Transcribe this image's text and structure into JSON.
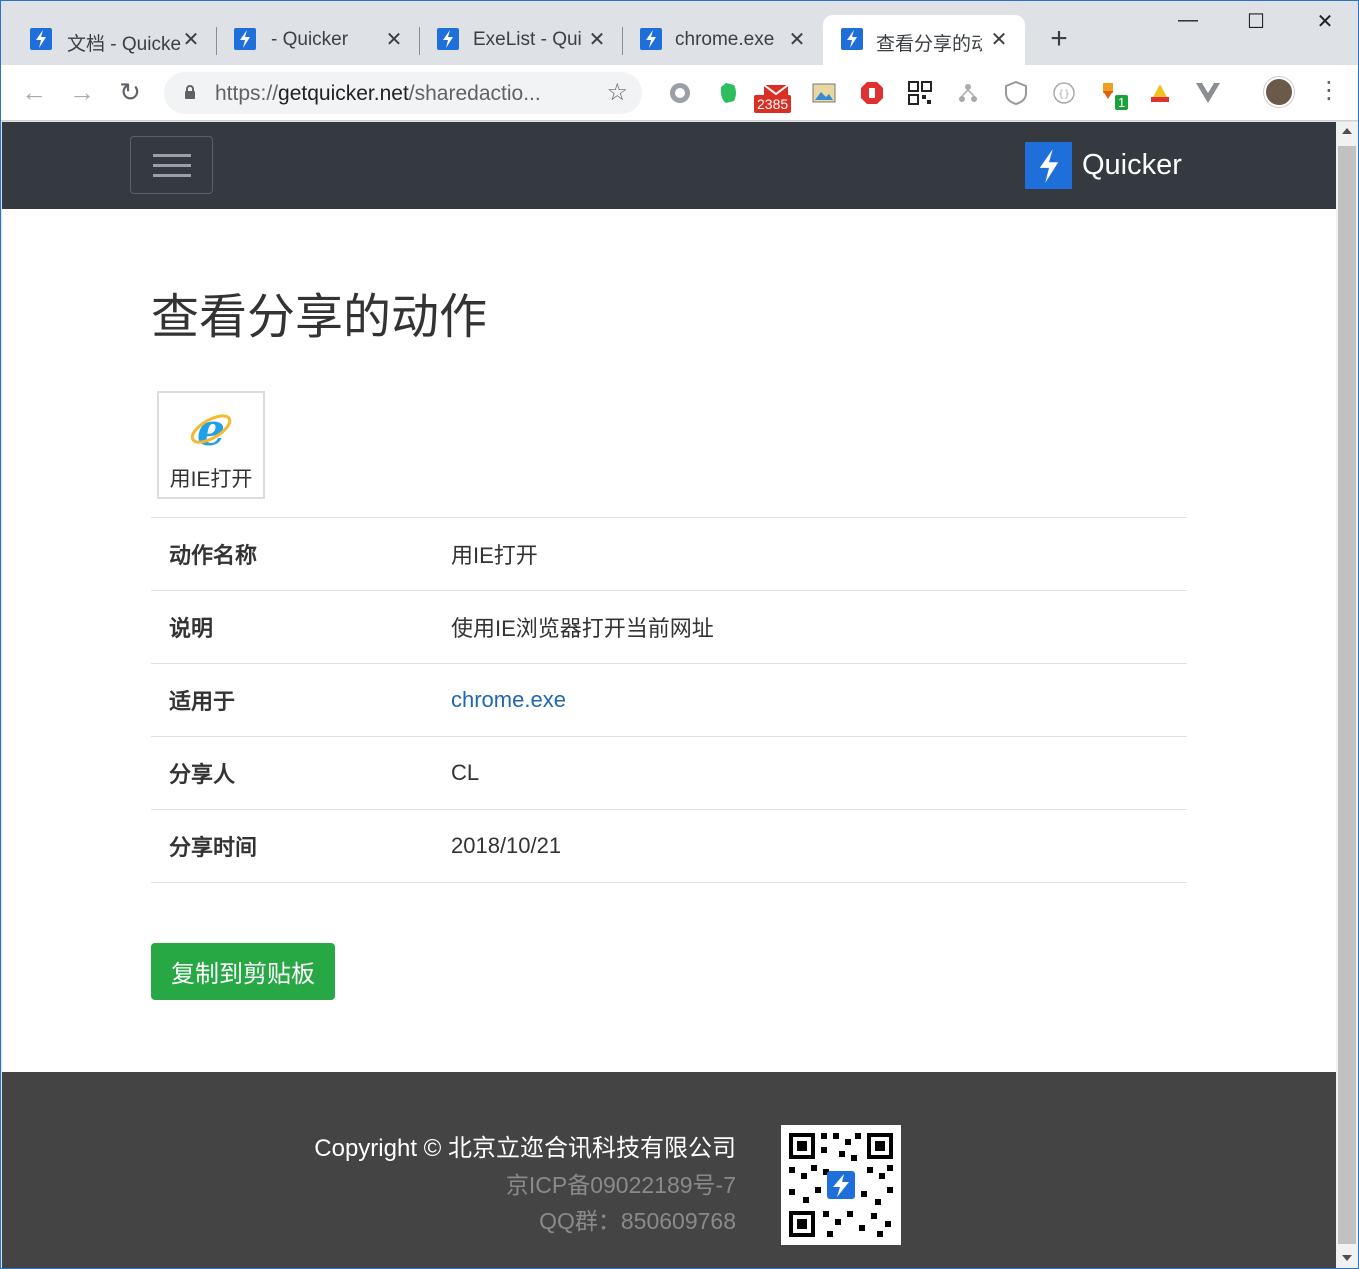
{
  "browser": {
    "tabs": [
      {
        "title": "文档 - Quicker"
      },
      {
        "title": "- Quicker"
      },
      {
        "title": "ExeList - Quicker"
      },
      {
        "title": "chrome.exe"
      },
      {
        "title": "查看分享的动作"
      }
    ],
    "close_glyph": "✕",
    "new_tab_glyph": "+",
    "window_controls": {
      "minimize": "—",
      "maximize": "☐",
      "close": "✕"
    },
    "url_prefix": "https://",
    "url_host": "getquicker.net",
    "url_path": "/sharedactio...",
    "back_glyph": "←",
    "forward_glyph": "→",
    "reload_glyph": "↻",
    "star_glyph": "☆",
    "menu_glyph": "⋮",
    "mail_badge": "2385",
    "ext_badge": "1"
  },
  "site": {
    "brand_name": "Quicker",
    "brand_color": "#1e6fd9",
    "nav_bg": "#343a40"
  },
  "page": {
    "title": "查看分享的动作",
    "tile_label": "用IE打开",
    "rows": [
      {
        "label": "动作名称",
        "value": "用IE打开"
      },
      {
        "label": "说明",
        "value": "使用IE浏览器打开当前网址"
      },
      {
        "label": "适用于",
        "value": "chrome.exe"
      },
      {
        "label": "分享人",
        "value": "CL"
      },
      {
        "label": "分享时间",
        "value": "2018/10/21"
      }
    ],
    "copy_button": "复制到剪贴板",
    "button_color": "#28a745",
    "link_color": "#2168b0"
  },
  "footer": {
    "copyright": "Copyright © 北京立迩合讯科技有限公司",
    "icp": "京ICP备09022189号-7",
    "qq": "QQ群：850609768"
  }
}
